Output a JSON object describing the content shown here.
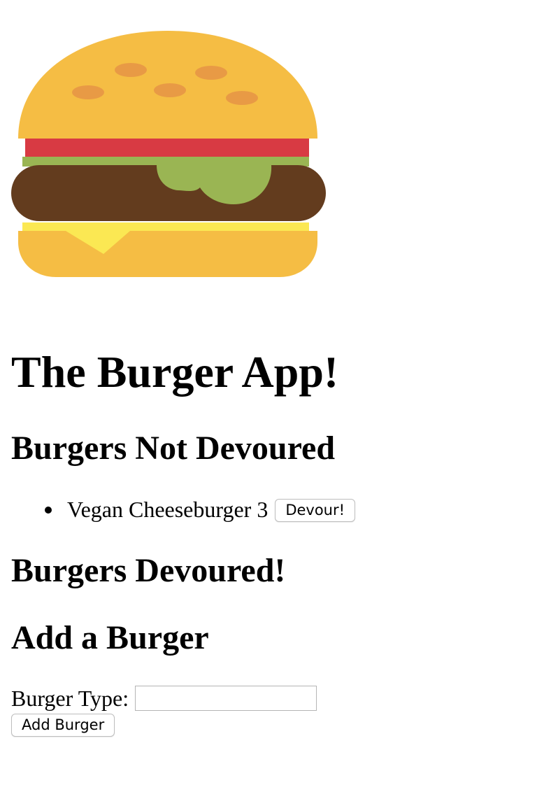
{
  "logo": {
    "icon": "burger-icon",
    "colors": {
      "bun": "#f5bd44",
      "sesame": "#e89a45",
      "tomato": "#d83a43",
      "lettuce": "#9ab553",
      "patty": "#633c1e",
      "cheese": "#fbe853"
    }
  },
  "page": {
    "title": "The Burger App!"
  },
  "not_devoured": {
    "heading": "Burgers Not Devoured",
    "items": [
      {
        "name": "Vegan Cheeseburger 3",
        "button_label": "Devour!"
      }
    ]
  },
  "devoured": {
    "heading": "Burgers Devoured!"
  },
  "add_burger": {
    "heading": "Add a Burger",
    "label": "Burger Type:",
    "input_value": "",
    "button_label": "Add Burger"
  }
}
